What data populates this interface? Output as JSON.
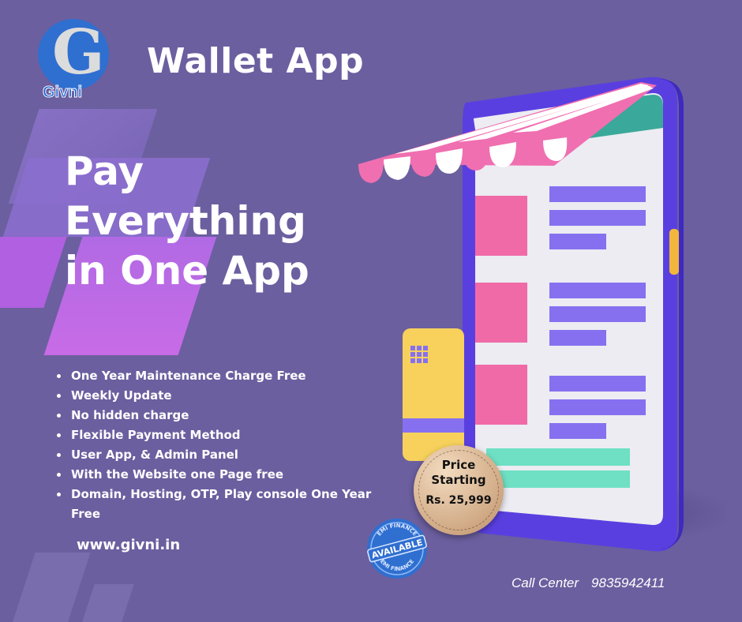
{
  "brand": {
    "logo_letter": "G",
    "logo_name": "Givni"
  },
  "title": "Wallet App",
  "headline": [
    "Pay",
    "Everything",
    "in One App"
  ],
  "features": [
    "One Year Maintenance Charge Free",
    "Weekly Update",
    "No hidden charge",
    "Flexible Payment Method",
    "User App, & Admin Panel",
    "With the Website one Page free",
    "Domain, Hosting, OTP, Play console One Year Free"
  ],
  "website": "www.givni.in",
  "price_badge": {
    "line1": "Price",
    "line2": "Starting",
    "price": "Rs. 25,999"
  },
  "emi_badge": {
    "top": "EMI FINANCE",
    "center": "AVAILABLE",
    "bottom": "EMI FINANCE"
  },
  "contact": {
    "label": "Call Center",
    "phone": "9835942411"
  },
  "colors": {
    "background": "#6b5f9f",
    "accent_purple": "#c064e6",
    "phone_frame": "#5a3fe0",
    "awning_pink": "#f06fb0",
    "block_pink": "#f06aa8",
    "bar_purple": "#8670f0",
    "bar_teal": "#6fe0c4",
    "card_yellow": "#f7d15c",
    "logo_blue": "#2f6fd0"
  },
  "icons": [
    "g-logo-icon",
    "smartphone-illustration",
    "credit-card-icon",
    "emi-seal-icon"
  ]
}
